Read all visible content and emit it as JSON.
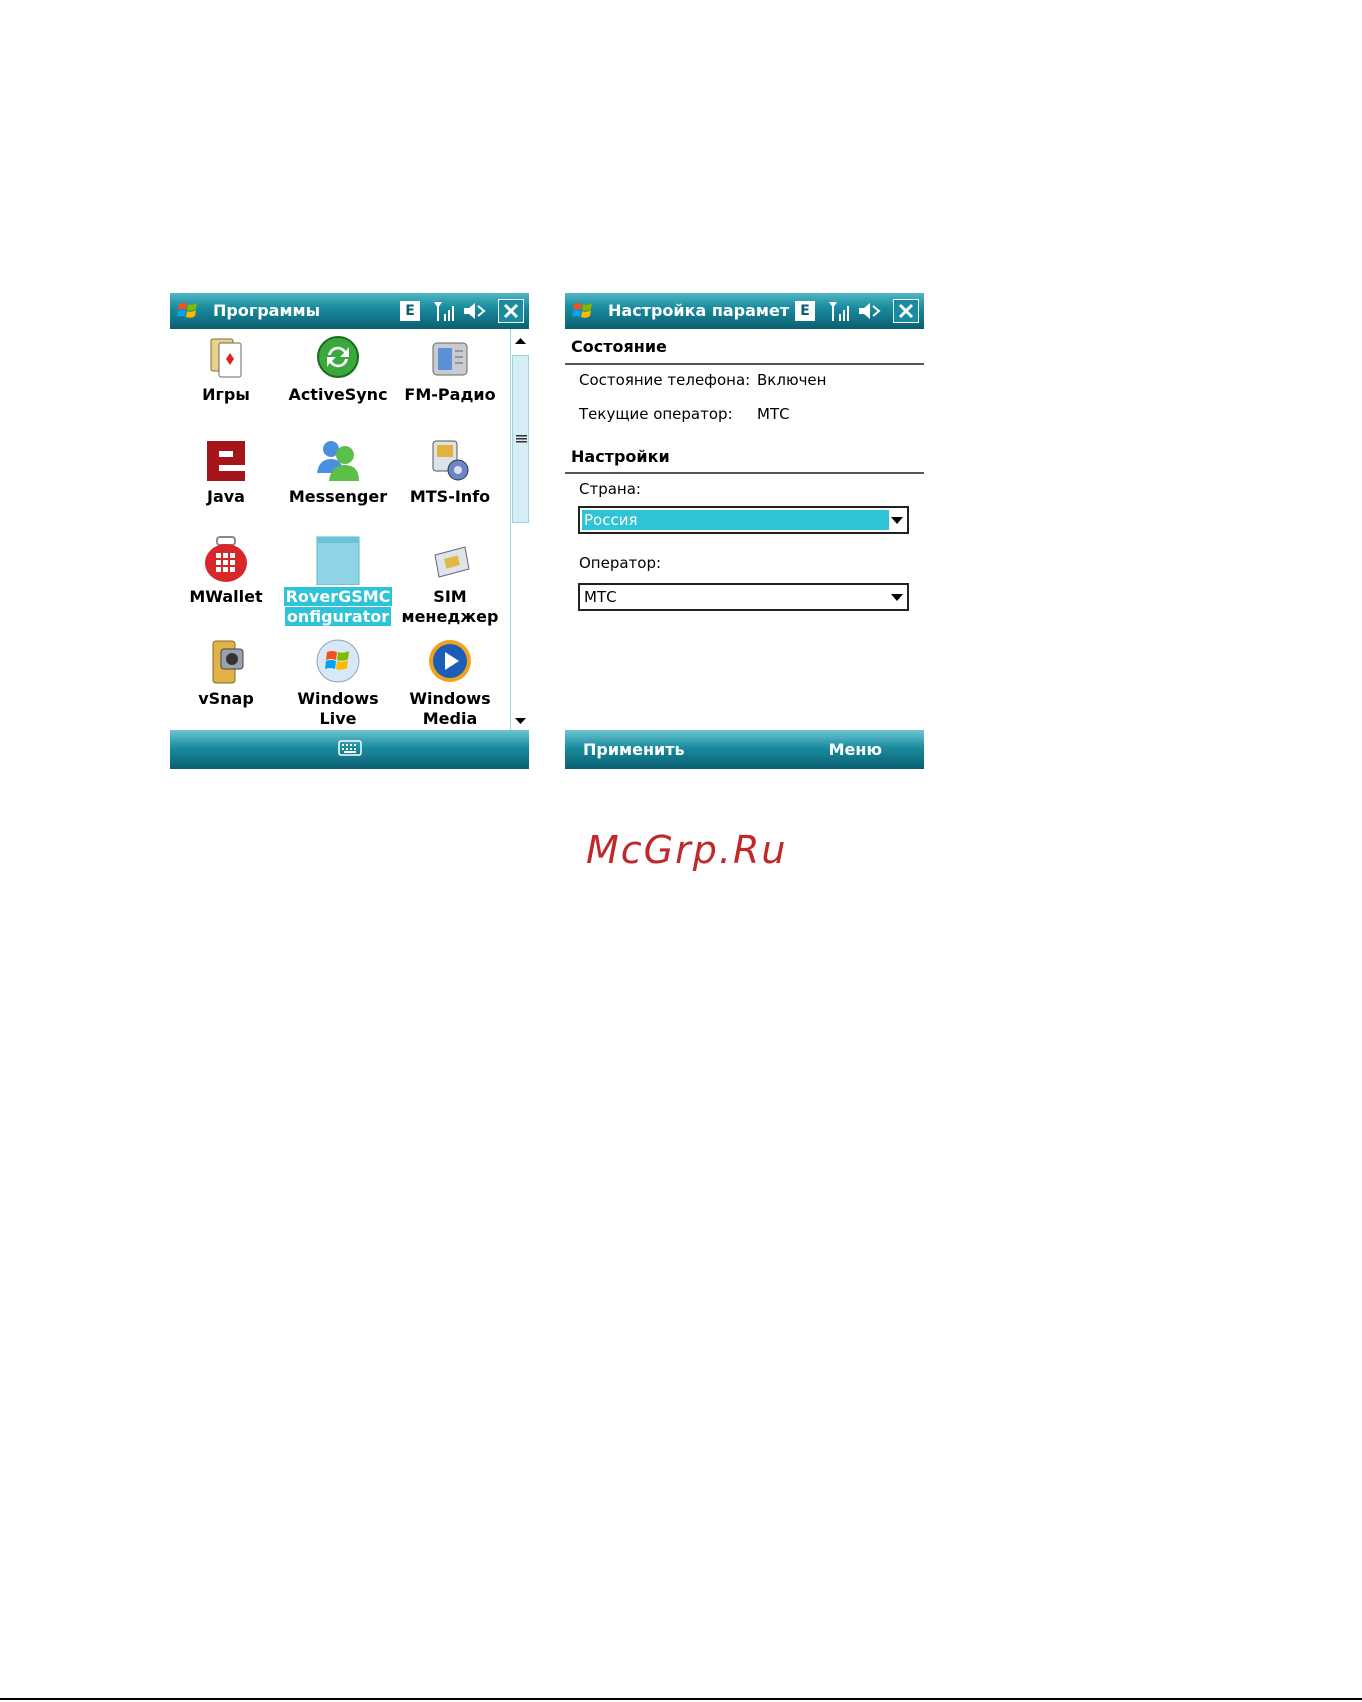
{
  "left_screen": {
    "title": "Программы",
    "status_letter": "E",
    "programs": [
      {
        "label_line1": "Игры",
        "label_line2": "",
        "icon": "games-icon"
      },
      {
        "label_line1": "ActiveSync",
        "label_line2": "",
        "icon": "activesync-icon"
      },
      {
        "label_line1": "FM-Радио",
        "label_line2": "",
        "icon": "radio-icon"
      },
      {
        "label_line1": "Java",
        "label_line2": "",
        "icon": "java-icon"
      },
      {
        "label_line1": "Messenger",
        "label_line2": "",
        "icon": "messenger-icon"
      },
      {
        "label_line1": "MTS-Info",
        "label_line2": "",
        "icon": "mts-info-icon"
      },
      {
        "label_line1": "MWallet",
        "label_line2": "",
        "icon": "wallet-icon"
      },
      {
        "label_line1": "RoverGSMC",
        "label_line2": "onfigurator",
        "icon": "folder-icon",
        "selected": true
      },
      {
        "label_line1": "SIM",
        "label_line2": "менеджер",
        "icon": "sim-card-icon"
      },
      {
        "label_line1": "vSnap",
        "label_line2": "",
        "icon": "camera-icon"
      },
      {
        "label_line1": "Windows",
        "label_line2": "Live",
        "icon": "windows-live-icon"
      },
      {
        "label_line1": "Windows",
        "label_line2": "Media",
        "icon": "windows-media-icon"
      }
    ]
  },
  "right_screen": {
    "title": "Настройка парамет",
    "status_letter": "E",
    "section_state": "Состояние",
    "phone_state_label": "Состояние телефона:",
    "phone_state_value": "Включен",
    "operator_label": "Текущие оператор:",
    "operator_value": "МТС",
    "section_settings": "Настройки",
    "country_label": "Страна:",
    "country_value": "Россия",
    "operator_field_label": "Оператор:",
    "operator_field_value": "МТС",
    "softkey_left": "Применить",
    "softkey_right": "Меню"
  },
  "watermark": "McGrp.Ru",
  "colors": {
    "titlebar": "#1a8c9f",
    "selection": "#2ec3d6",
    "watermark": "#c0282c"
  }
}
